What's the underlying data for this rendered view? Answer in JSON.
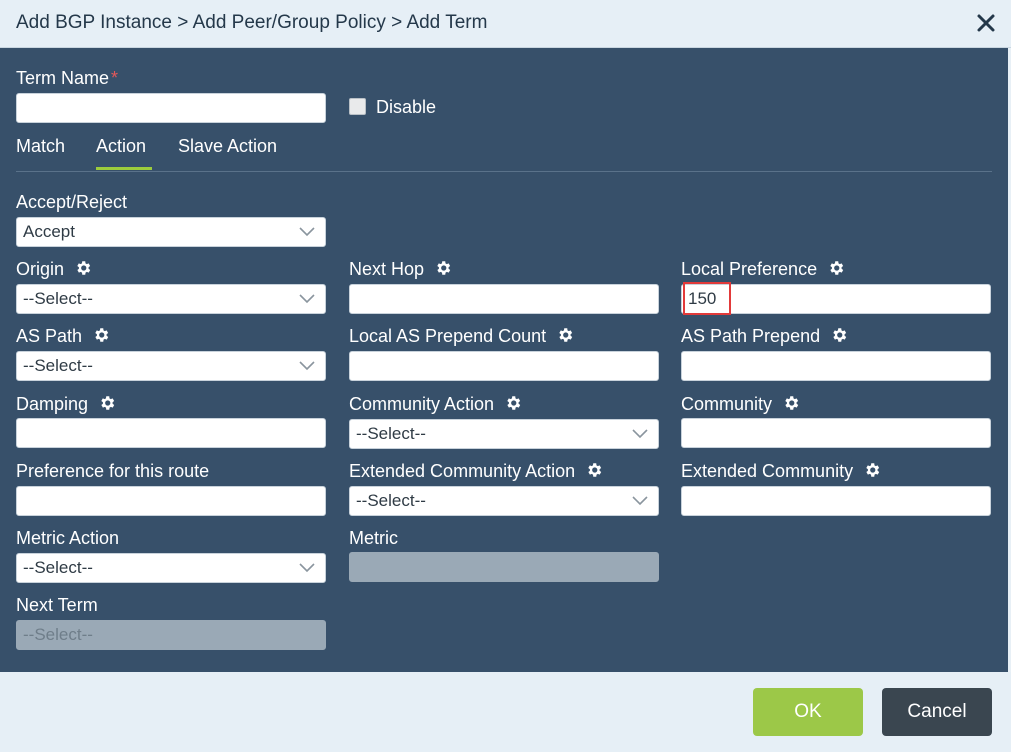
{
  "dialog": {
    "title": "Add BGP Instance > Add Peer/Group Policy > Add Term"
  },
  "term": {
    "name_label": "Term Name",
    "required_mark": "*",
    "name_value": "",
    "disable_label": "Disable",
    "disable_checked": false
  },
  "tabs": [
    {
      "label": "Match",
      "active": false
    },
    {
      "label": "Action",
      "active": true
    },
    {
      "label": "Slave Action",
      "active": false
    }
  ],
  "fields": {
    "accept_reject": {
      "label": "Accept/Reject",
      "value": "Accept"
    },
    "origin": {
      "label": "Origin",
      "value": "--Select--"
    },
    "next_hop": {
      "label": "Next Hop",
      "value": ""
    },
    "local_preference": {
      "label": "Local Preference",
      "value": "150"
    },
    "as_path": {
      "label": "AS Path",
      "value": "--Select--"
    },
    "local_as_prepend_count": {
      "label": "Local AS Prepend Count",
      "value": ""
    },
    "as_path_prepend": {
      "label": "AS Path Prepend",
      "value": ""
    },
    "damping": {
      "label": "Damping",
      "value": ""
    },
    "community_action": {
      "label": "Community Action",
      "value": "--Select--"
    },
    "community": {
      "label": "Community",
      "value": ""
    },
    "preference": {
      "label": "Preference for this route",
      "value": ""
    },
    "ext_community_action": {
      "label": "Extended Community Action",
      "value": "--Select--"
    },
    "ext_community": {
      "label": "Extended Community",
      "value": ""
    },
    "metric_action": {
      "label": "Metric Action",
      "value": "--Select--"
    },
    "metric": {
      "label": "Metric",
      "value": ""
    },
    "next_term": {
      "label": "Next Term",
      "value": "--Select--"
    }
  },
  "buttons": {
    "ok": "OK",
    "cancel": "Cancel"
  },
  "colors": {
    "panel": "#37506a",
    "accent": "#9cc848",
    "highlight": "#e23a3a"
  }
}
